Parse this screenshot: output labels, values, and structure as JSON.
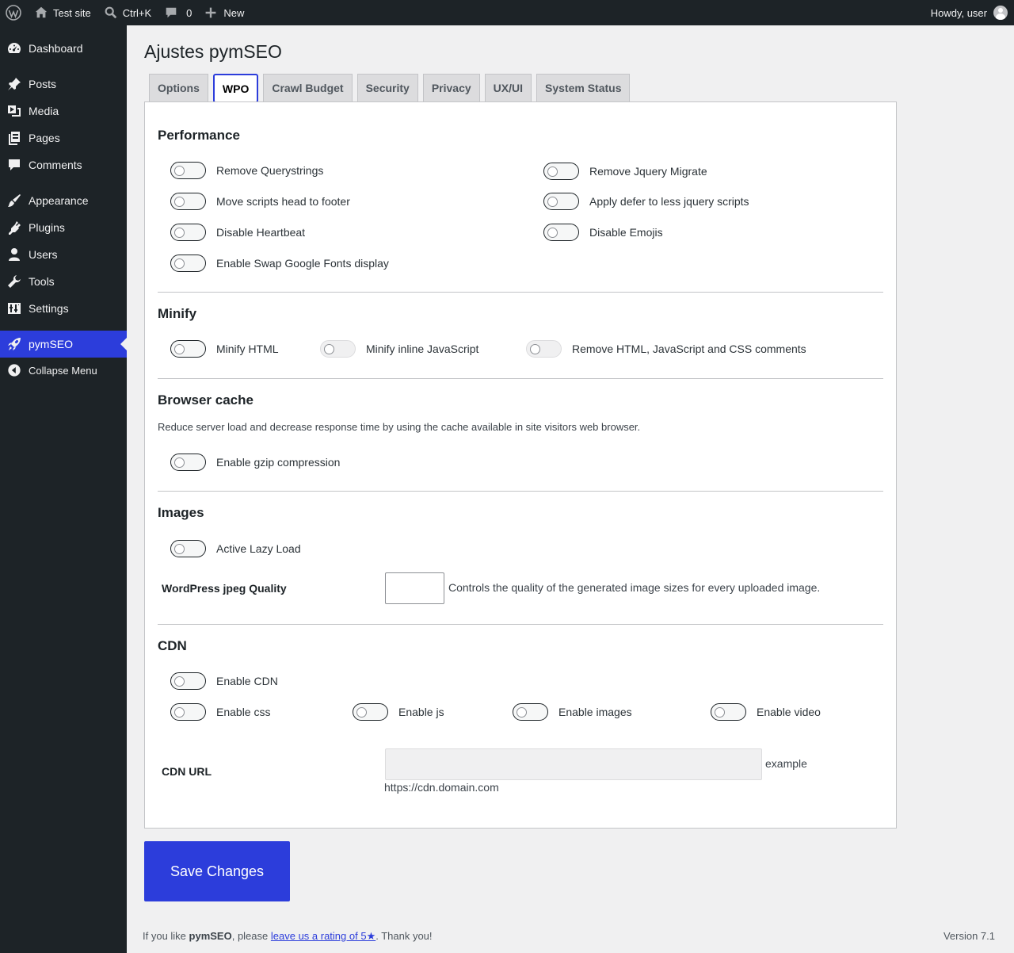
{
  "adminbar": {
    "site_name": "Test site",
    "search_shortcut": "Ctrl+K",
    "comments_count": "0",
    "new_label": "New",
    "greeting": "Howdy, user"
  },
  "sidebar": {
    "items": [
      {
        "label": "Dashboard",
        "icon": "dashboard-icon"
      },
      {
        "label": "Posts",
        "icon": "pushpin-icon"
      },
      {
        "label": "Media",
        "icon": "media-icon"
      },
      {
        "label": "Pages",
        "icon": "pages-icon"
      },
      {
        "label": "Comments",
        "icon": "comment-icon"
      },
      {
        "label": "Appearance",
        "icon": "brush-icon"
      },
      {
        "label": "Plugins",
        "icon": "plugin-icon"
      },
      {
        "label": "Users",
        "icon": "user-icon"
      },
      {
        "label": "Tools",
        "icon": "wrench-icon"
      },
      {
        "label": "Settings",
        "icon": "settings-icon"
      },
      {
        "label": "pymSEO",
        "icon": "rocket-icon"
      }
    ],
    "collapse_label": "Collapse Menu",
    "accent": "#2c3ddb"
  },
  "page": {
    "title": "Ajustes pymSEO",
    "tabs": [
      "Options",
      "WPO",
      "Crawl Budget",
      "Security",
      "Privacy",
      "UX/UI",
      "System Status"
    ],
    "active_tab": "WPO"
  },
  "performance": {
    "title": "Performance",
    "toggles": [
      {
        "label": "Remove Querystrings",
        "on": false
      },
      {
        "label": "Remove Jquery Migrate",
        "on": false
      },
      {
        "label": "Move scripts head to footer",
        "on": false
      },
      {
        "label": "Apply defer to less jquery scripts",
        "on": false
      },
      {
        "label": "Disable Heartbeat",
        "on": false
      },
      {
        "label": "Disable Emojis",
        "on": false
      },
      {
        "label": "Enable Swap Google Fonts display",
        "on": false
      }
    ]
  },
  "minify": {
    "title": "Minify",
    "toggles": [
      {
        "label": "Minify HTML",
        "on": false,
        "disabled": false
      },
      {
        "label": "Minify inline JavaScript",
        "on": false,
        "disabled": true
      },
      {
        "label": "Remove HTML, JavaScript and CSS comments",
        "on": false,
        "disabled": true
      }
    ]
  },
  "browser_cache": {
    "title": "Browser cache",
    "description": "Reduce server load and decrease response time by using the cache available in site visitors web browser.",
    "toggles": [
      {
        "label": "Enable gzip compression",
        "on": false
      }
    ]
  },
  "images": {
    "title": "Images",
    "toggles": [
      {
        "label": "Active Lazy Load",
        "on": false
      }
    ],
    "jpeg_label": "WordPress jpeg Quality",
    "jpeg_value": "",
    "jpeg_desc": "Controls the quality of the generated image sizes for every uploaded image."
  },
  "cdn": {
    "title": "CDN",
    "toggles": [
      {
        "label": "Enable CDN",
        "on": false
      },
      {
        "label": "Enable css",
        "on": false
      },
      {
        "label": "Enable js",
        "on": false
      },
      {
        "label": "Enable images",
        "on": false
      },
      {
        "label": "Enable video",
        "on": false
      }
    ],
    "url_label": "CDN URL",
    "url_value": "",
    "url_hint_1": "example",
    "url_hint_2": "https://cdn.domain.com"
  },
  "save_label": "Save Changes",
  "footer": {
    "prefix": "If you like ",
    "brand": "pymSEO",
    "middle": ", please ",
    "link": "leave us a rating of 5★",
    "suffix": ". Thank you!",
    "version": "Version 7.1"
  }
}
